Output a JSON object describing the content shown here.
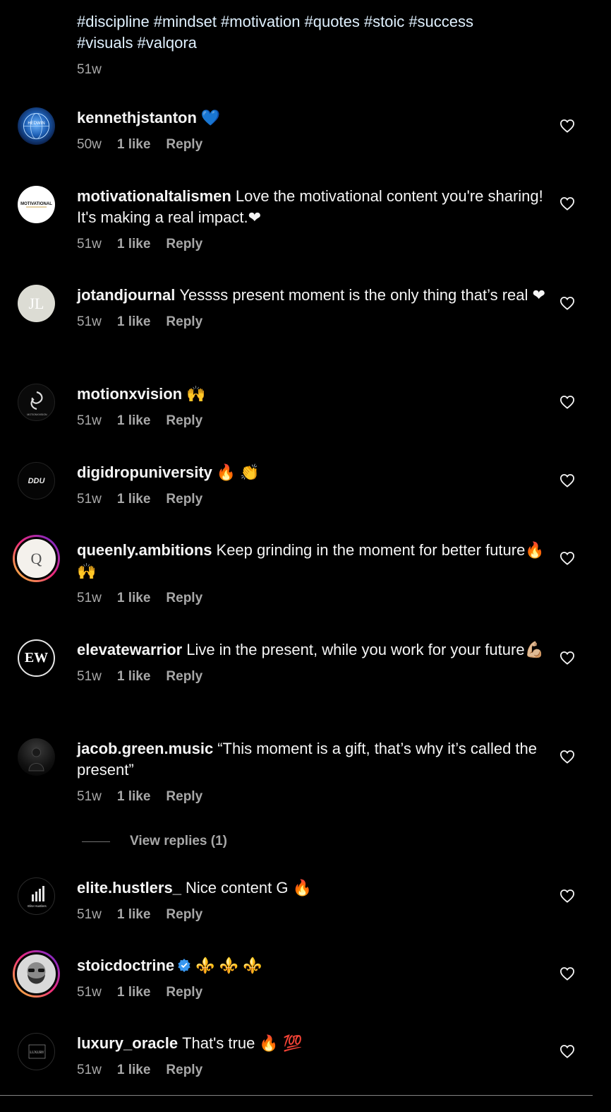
{
  "caption": {
    "hashtags": [
      "#discipline",
      "#mindset",
      "#motivation",
      "#quotes",
      "#stoic",
      "#success",
      "#visuals",
      "#valqora"
    ],
    "time": "51w"
  },
  "comments": [
    {
      "username": "kennethjstanton",
      "text": "💙",
      "time": "50w",
      "likes": "1 like",
      "reply": "Reply",
      "avatar_text": "HEDWIN",
      "avatar_icon": "globe-avatar"
    },
    {
      "username": "motivationaltalismen",
      "text": "Love the motivational content you're sharing! It's making a real impact.❤",
      "time": "51w",
      "likes": "1 like",
      "reply": "Reply",
      "avatar_text": "MOTIVATIONAL",
      "avatar_icon": "logo-avatar"
    },
    {
      "username": "jotandjournal",
      "text": "Yessss present moment is the only thing that’s real ❤",
      "time": "51w",
      "likes": "1 like",
      "reply": "Reply",
      "avatar_text": "JL",
      "avatar_icon": "monogram-avatar"
    },
    {
      "username": "motionxvision",
      "text": "🙌",
      "time": "51w",
      "likes": "1 like",
      "reply": "Reply",
      "avatar_text": "MOTIONXVISION",
      "avatar_icon": "swirl-avatar"
    },
    {
      "username": "digidropuniversity",
      "text": "🔥 👏",
      "time": "51w",
      "likes": "1 like",
      "reply": "Reply",
      "avatar_text": "DDU",
      "avatar_icon": "logo-avatar"
    },
    {
      "username": "queenly.ambitions",
      "text": "Keep grinding in the moment for better future🔥🙌",
      "time": "51w",
      "likes": "1 like",
      "reply": "Reply",
      "avatar_text": "Q",
      "avatar_icon": "monogram-avatar"
    },
    {
      "username": "elevatewarrior",
      "text": "Live in the present, while you work for your future💪🏼",
      "time": "51w",
      "likes": "1 like",
      "reply": "Reply",
      "avatar_text": "EW",
      "avatar_icon": "monogram-avatar"
    },
    {
      "username": "jacob.green.music",
      "text": "“This moment is a gift, that’s why it’s called the present”",
      "time": "51w",
      "likes": "1 like",
      "reply": "Reply",
      "avatar_text": "",
      "avatar_icon": "person-avatar"
    },
    {
      "username": "elite.hustlers_",
      "text": "Nice content G 🔥",
      "time": "51w",
      "likes": "1 like",
      "reply": "Reply",
      "avatar_text": "Elite Hustlers",
      "avatar_icon": "chart-avatar"
    },
    {
      "username": "stoicdoctrine",
      "text": "⚜️ ⚜️ ⚜️",
      "time": "51w",
      "likes": "1 like",
      "reply": "Reply",
      "avatar_text": "",
      "avatar_icon": "face-avatar",
      "verified": true
    },
    {
      "username": "luxury_oracle",
      "text": "That's true 🔥 💯",
      "time": "51w",
      "likes": "1 like",
      "reply": "Reply",
      "avatar_text": "LUXURY",
      "avatar_icon": "logo-avatar"
    }
  ],
  "view_replies": {
    "label": "View replies (1)"
  },
  "colors": {
    "background": "#000000",
    "text": "#f5f5f5",
    "secondary": "#a8a8a8",
    "hashtag": "#e0f1ff",
    "verified": "#3897f0"
  }
}
